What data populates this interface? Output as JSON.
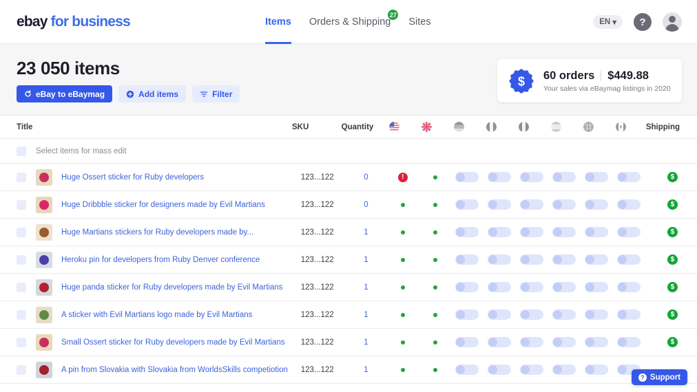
{
  "header": {
    "logo_ebay": "ebay",
    "logo_for_business": "for business",
    "nav": [
      {
        "label": "Items",
        "badge": "",
        "active": true
      },
      {
        "label": "Orders & Shipping",
        "badge": "27",
        "active": false
      },
      {
        "label": "Sites",
        "badge": "",
        "active": false
      }
    ],
    "language": "EN",
    "language_caret": "▾",
    "help_icon": "?",
    "avatar_icon": "user-avatar"
  },
  "page": {
    "title": "23 050 items",
    "buttons": [
      {
        "label": "eBay to eBaymag",
        "icon": "refresh-icon",
        "style": "primary"
      },
      {
        "label": "Add items",
        "icon": "plus-circle-icon",
        "style": "light"
      },
      {
        "label": "Filter",
        "icon": "filter-icon",
        "style": "light"
      }
    ]
  },
  "sales_card": {
    "orders": "60 orders",
    "amount": "$449.88",
    "subtitle": "Your sales via eBaymag listings in 2020",
    "badge_symbol": "$",
    "badge_color": "#3558e8"
  },
  "table": {
    "columns": {
      "title": "Title",
      "sku": "SKU",
      "quantity": "Quantity",
      "shipping": "Shipping"
    },
    "marketplaces": [
      {
        "name": "flag-us",
        "country": "US"
      },
      {
        "name": "flag-uk",
        "country": "UK"
      },
      {
        "name": "flag-de",
        "country": "DE"
      },
      {
        "name": "flag-fr",
        "country": "FR"
      },
      {
        "name": "flag-it",
        "country": "IT"
      },
      {
        "name": "flag-es",
        "country": "ES"
      },
      {
        "name": "flag-au",
        "country": "AU"
      },
      {
        "name": "flag-ca",
        "country": "CA"
      }
    ],
    "mass_edit_label": "Select items for mass edit",
    "rows": [
      {
        "title": "Huge Ossert sticker for Ruby developers",
        "sku": "123...122",
        "quantity": "0",
        "status_us": "error",
        "status_uk": "ok",
        "toggles": 6,
        "shipping_badge": "$"
      },
      {
        "title": "Huge Dribbble sticker for designers made by Evil Martians",
        "sku": "123...122",
        "quantity": "0",
        "status_us": "ok",
        "status_uk": "ok",
        "toggles": 6,
        "shipping_badge": "$"
      },
      {
        "title": "Huge Martians stickers for Ruby developers made by...",
        "sku": "123...122",
        "quantity": "1",
        "status_us": "ok",
        "status_uk": "ok",
        "toggles": 6,
        "shipping_badge": "$"
      },
      {
        "title": "Heroku pin for developers from Ruby Denver conference",
        "sku": "123...122",
        "quantity": "1",
        "status_us": "ok",
        "status_uk": "ok",
        "toggles": 6,
        "shipping_badge": "$"
      },
      {
        "title": "Huge panda sticker for Ruby developers made by Evil Martians",
        "sku": "123...122",
        "quantity": "1",
        "status_us": "ok",
        "status_uk": "ok",
        "toggles": 6,
        "shipping_badge": "$"
      },
      {
        "title": "A sticker with Evil Martians logo made by Evil Martians",
        "sku": "123...122",
        "quantity": "1",
        "status_us": "ok",
        "status_uk": "ok",
        "toggles": 6,
        "shipping_badge": "$"
      },
      {
        "title": "Small Ossert sticker for Ruby developers made by Evil Martians",
        "sku": "123...122",
        "quantity": "1",
        "status_us": "ok",
        "status_uk": "ok",
        "toggles": 6,
        "shipping_badge": "$"
      },
      {
        "title": "A pin from Slovakia with Slovakia from WorldsSkills competiotion",
        "sku": "123...122",
        "quantity": "1",
        "status_us": "ok",
        "status_uk": "ok",
        "toggles": 6,
        "shipping_badge": ""
      }
    ]
  },
  "support": {
    "label": "Support",
    "icon": "question-icon"
  },
  "colors": {
    "brand_blue": "#3558e8",
    "link_blue": "#3d63d8",
    "green": "#22a340",
    "red": "#dd1f3c",
    "band_bg": "#f6f6f7"
  }
}
